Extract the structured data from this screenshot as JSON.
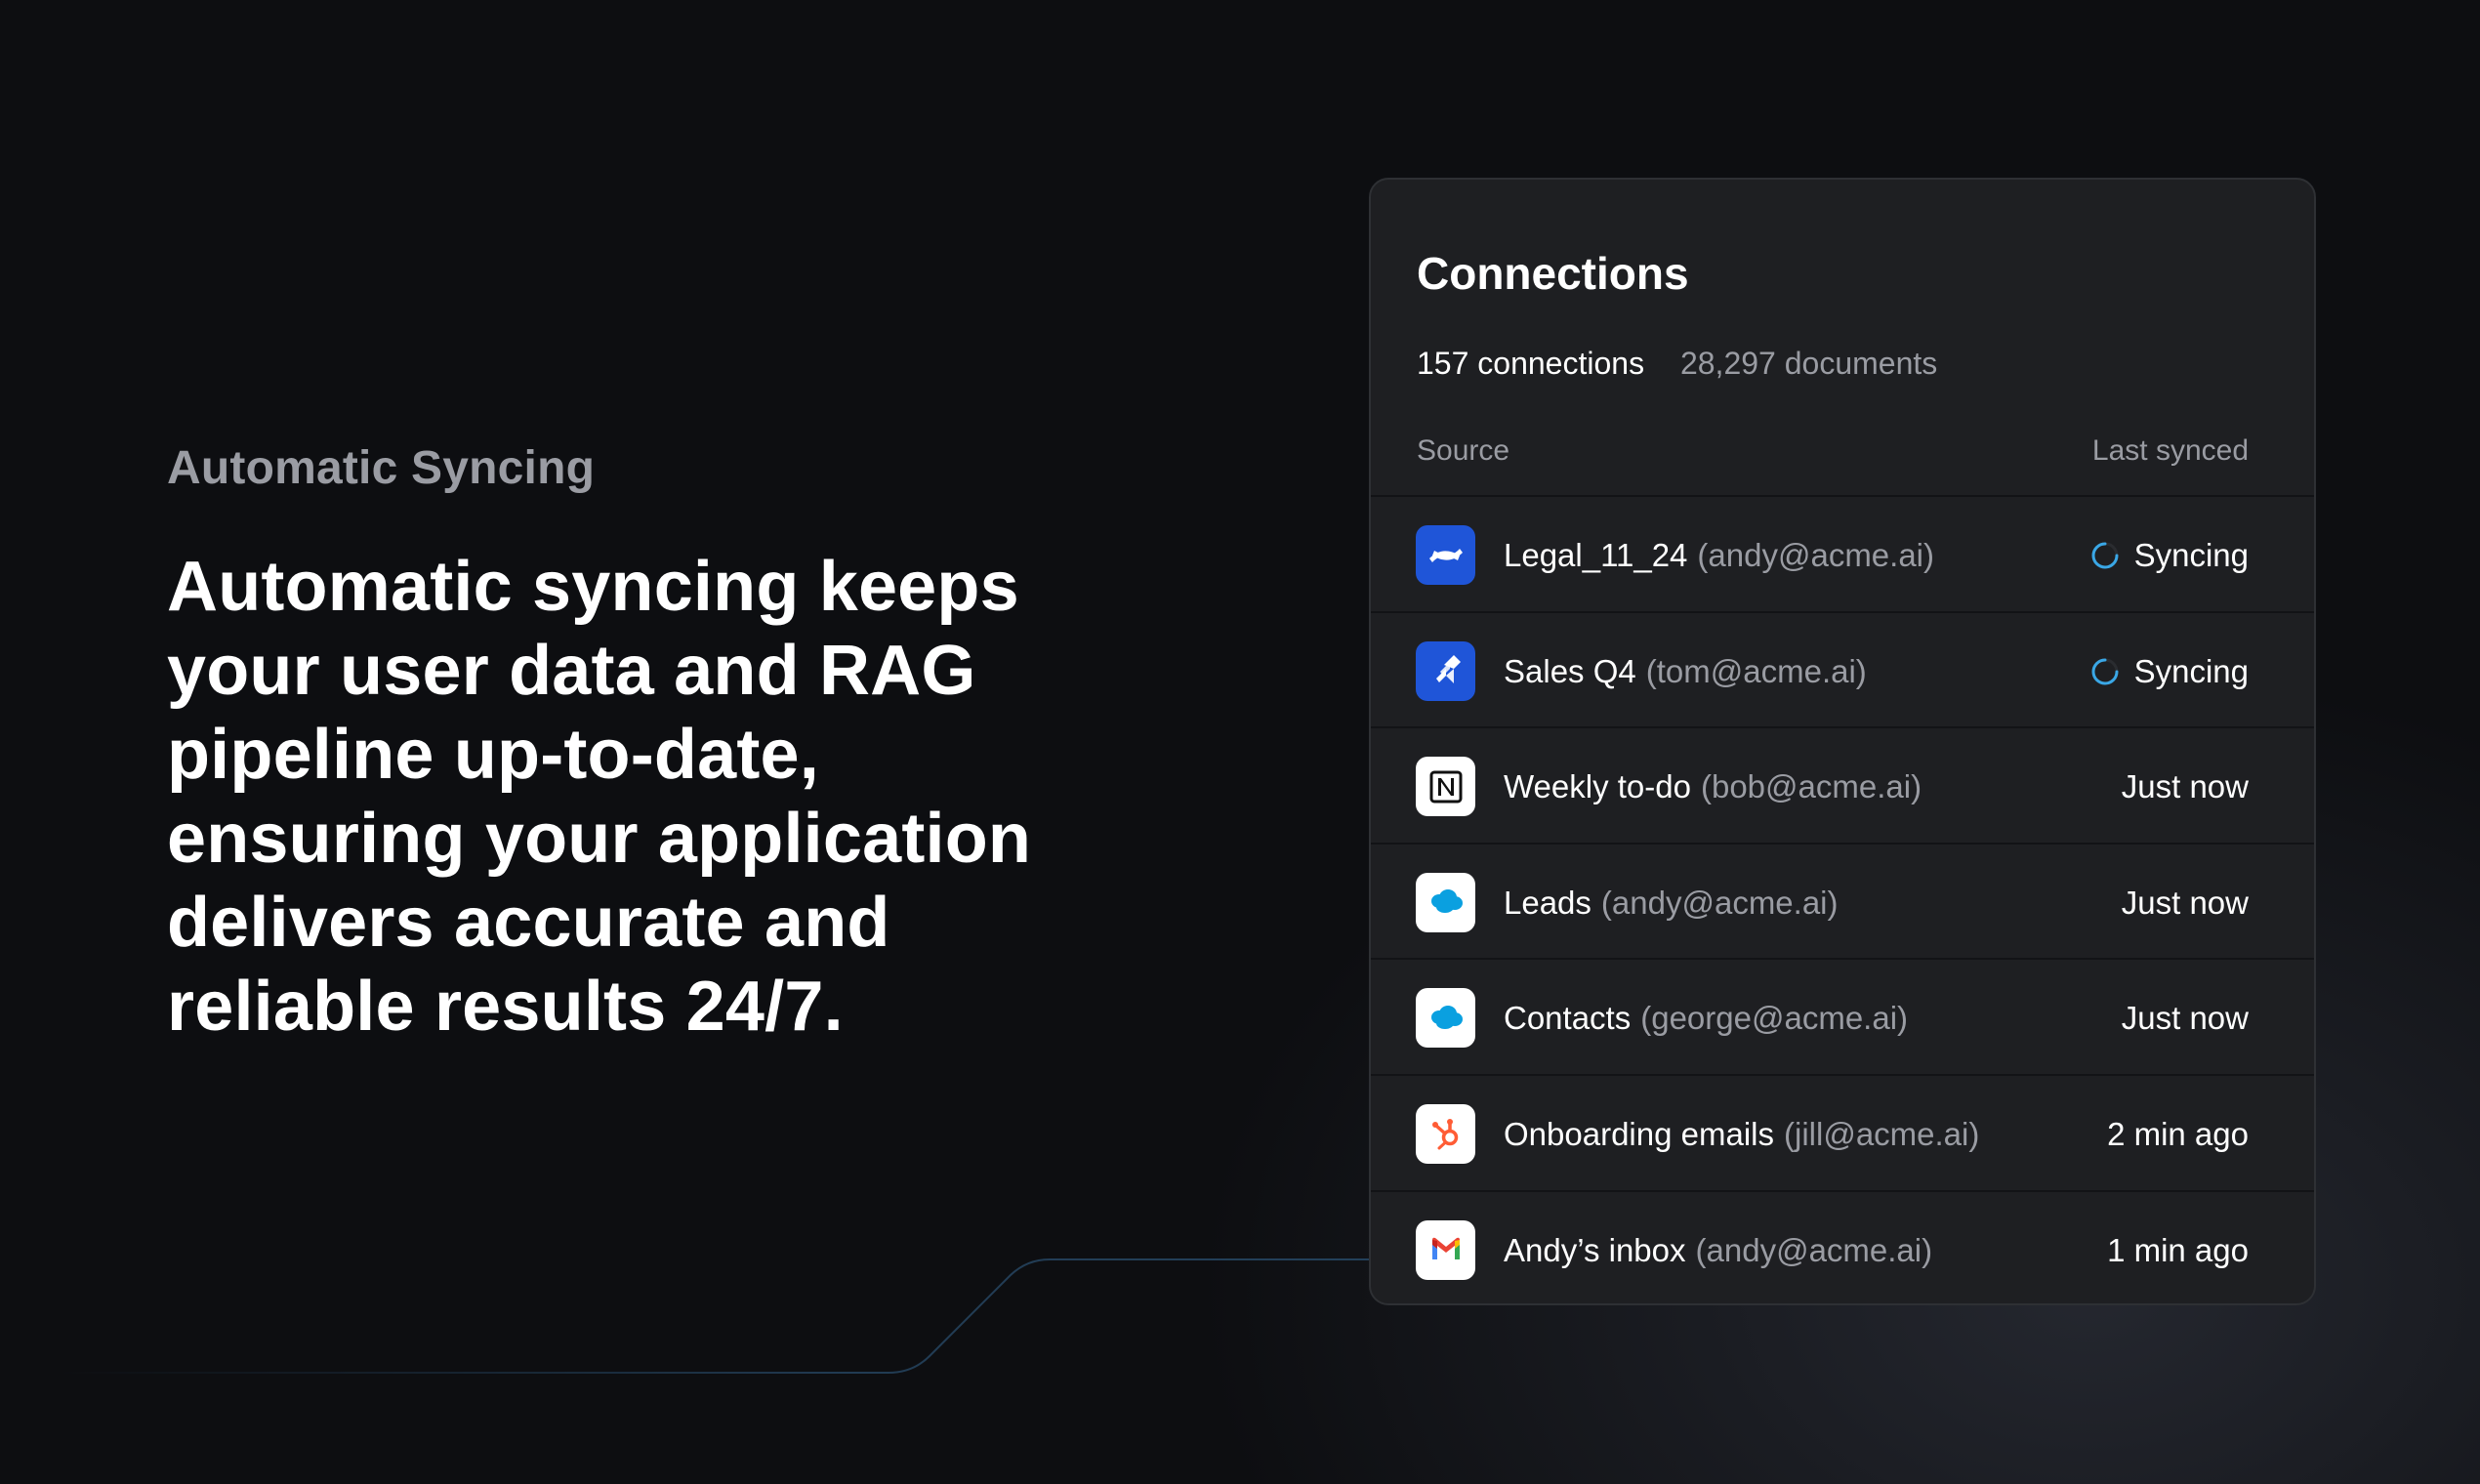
{
  "intro": {
    "eyebrow": "Automatic Syncing",
    "headline": "Automatic syncing keeps your user data and RAG pipeline up-to-date, ensuring your application delivers accurate and reliable results 24/7."
  },
  "panel": {
    "title": "Connections",
    "stats": {
      "connections": "157 connections",
      "documents": "28,297 documents"
    },
    "columns": {
      "source": "Source",
      "last_synced": "Last synced"
    },
    "rows": [
      {
        "name": "Legal_11_24",
        "owner": "(andy@acme.ai)",
        "status": "Syncing",
        "icon": "confluence-icon",
        "syncing": true
      },
      {
        "name": "Sales Q4",
        "owner": "(tom@acme.ai)",
        "status": "Syncing",
        "icon": "jira-icon",
        "syncing": true
      },
      {
        "name": "Weekly to-do",
        "owner": "(bob@acme.ai)",
        "status": "Just now",
        "icon": "notion-icon",
        "syncing": false
      },
      {
        "name": "Leads",
        "owner": "(andy@acme.ai)",
        "status": "Just now",
        "icon": "salesforce-icon",
        "syncing": false
      },
      {
        "name": "Contacts",
        "owner": "(george@acme.ai)",
        "status": "Just now",
        "icon": "salesforce-icon",
        "syncing": false
      },
      {
        "name": "Onboarding emails",
        "owner": "(jill@acme.ai)",
        "status": "2 min ago",
        "icon": "hubspot-icon",
        "syncing": false
      },
      {
        "name": "Andy’s inbox",
        "owner": "(andy@acme.ai)",
        "status": "1 min ago",
        "icon": "gmail-icon",
        "syncing": false
      }
    ]
  },
  "colors": {
    "background": "#0d0e11",
    "panel": "#1e1f22",
    "muted_text": "#9a9ca3",
    "spinner": "#3aa7e6",
    "confluence_blue": "#1f55d8",
    "jira_blue": "#1f55d8",
    "salesforce_blue": "#0aa0e0",
    "hubspot_orange": "#ff5c35"
  }
}
